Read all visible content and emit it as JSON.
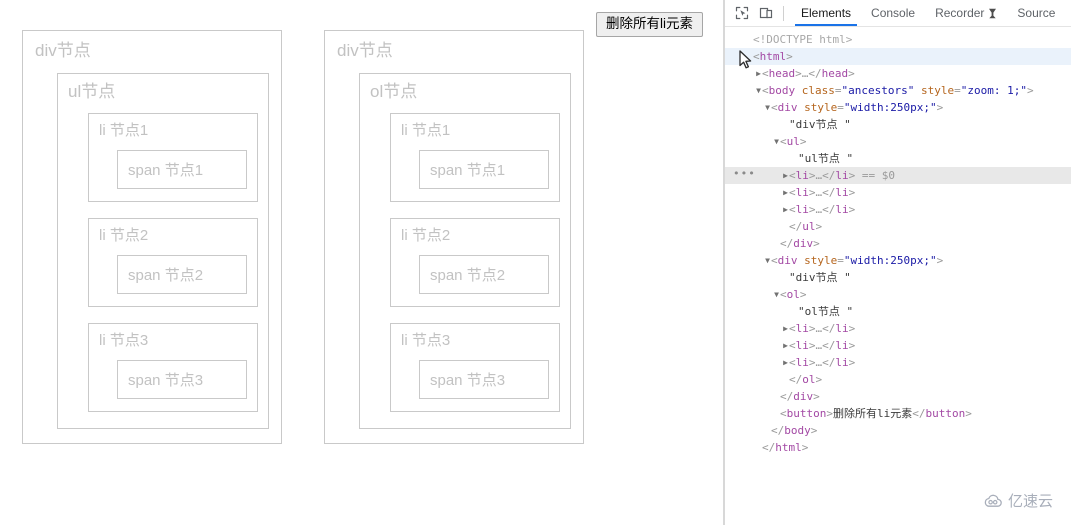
{
  "page": {
    "columns": [
      {
        "container_label": "div节点",
        "list_label": "ul节点",
        "items": [
          {
            "li_label": "li 节点1",
            "span_label": "span 节点1"
          },
          {
            "li_label": "li 节点2",
            "span_label": "span 节点2"
          },
          {
            "li_label": "li 节点3",
            "span_label": "span 节点3"
          }
        ]
      },
      {
        "container_label": "div节点",
        "list_label": "ol节点",
        "items": [
          {
            "li_label": "li 节点1",
            "span_label": "span 节点1"
          },
          {
            "li_label": "li 节点2",
            "span_label": "span 节点2"
          },
          {
            "li_label": "li 节点3",
            "span_label": "span 节点3"
          }
        ]
      }
    ],
    "delete_button_label": "删除所有li元素"
  },
  "devtools": {
    "toolbar": {
      "inspect_icon": "inspect-element-icon",
      "device_icon": "device-toolbar-icon"
    },
    "tabs": [
      {
        "label": "Elements",
        "active": true,
        "icon": ""
      },
      {
        "label": "Console",
        "active": false,
        "icon": ""
      },
      {
        "label": "Recorder",
        "active": false,
        "icon": "experiment-flask-icon"
      },
      {
        "label": "Source",
        "active": false,
        "icon": ""
      }
    ],
    "dom_rows": [
      {
        "indent": 0,
        "twisty": "",
        "highlight": "",
        "dots": false,
        "parts": [
          {
            "cls": "doctype",
            "t": "<!DOCTYPE html>"
          }
        ]
      },
      {
        "indent": 0,
        "twisty": "",
        "highlight": "light",
        "dots": false,
        "parts": [
          {
            "cls": "punct",
            "t": "<"
          },
          {
            "cls": "tagname",
            "t": "html"
          },
          {
            "cls": "punct",
            "t": ">"
          }
        ]
      },
      {
        "indent": 1,
        "twisty": "right",
        "highlight": "",
        "dots": false,
        "parts": [
          {
            "cls": "punct",
            "t": "<"
          },
          {
            "cls": "tagname",
            "t": "head"
          },
          {
            "cls": "punct",
            "t": ">…</"
          },
          {
            "cls": "tagname",
            "t": "head"
          },
          {
            "cls": "punct",
            "t": ">"
          }
        ]
      },
      {
        "indent": 1,
        "twisty": "down",
        "highlight": "",
        "dots": false,
        "parts": [
          {
            "cls": "punct",
            "t": "<"
          },
          {
            "cls": "tagname",
            "t": "body"
          },
          {
            "cls": "punct",
            "t": " "
          },
          {
            "cls": "attrname",
            "t": "class"
          },
          {
            "cls": "punct",
            "t": "="
          },
          {
            "cls": "attrval",
            "t": "\"ancestors\""
          },
          {
            "cls": "punct",
            "t": " "
          },
          {
            "cls": "attrname",
            "t": "style"
          },
          {
            "cls": "punct",
            "t": "="
          },
          {
            "cls": "attrval",
            "t": "\"zoom: 1;\""
          },
          {
            "cls": "punct",
            "t": ">"
          }
        ]
      },
      {
        "indent": 2,
        "twisty": "down",
        "highlight": "",
        "dots": false,
        "parts": [
          {
            "cls": "punct",
            "t": "<"
          },
          {
            "cls": "tagname",
            "t": "div"
          },
          {
            "cls": "punct",
            "t": " "
          },
          {
            "cls": "attrname",
            "t": "style"
          },
          {
            "cls": "punct",
            "t": "="
          },
          {
            "cls": "attrval",
            "t": "\"width:250px;\""
          },
          {
            "cls": "punct",
            "t": ">"
          }
        ]
      },
      {
        "indent": 4,
        "twisty": "",
        "highlight": "",
        "dots": false,
        "parts": [
          {
            "cls": "textnode",
            "t": "\"div节点 \""
          }
        ]
      },
      {
        "indent": 3,
        "twisty": "down",
        "highlight": "",
        "dots": false,
        "parts": [
          {
            "cls": "punct",
            "t": "<"
          },
          {
            "cls": "tagname",
            "t": "ul"
          },
          {
            "cls": "punct",
            "t": ">"
          }
        ]
      },
      {
        "indent": 5,
        "twisty": "",
        "highlight": "",
        "dots": false,
        "parts": [
          {
            "cls": "textnode",
            "t": "\"ul节点 \""
          }
        ]
      },
      {
        "indent": 4,
        "twisty": "right",
        "highlight": "grey",
        "dots": true,
        "parts": [
          {
            "cls": "punct",
            "t": "<"
          },
          {
            "cls": "tagname",
            "t": "li"
          },
          {
            "cls": "punct",
            "t": ">…</"
          },
          {
            "cls": "tagname",
            "t": "li"
          },
          {
            "cls": "punct",
            "t": ">"
          },
          {
            "cls": "dollar",
            "t": " == $0"
          }
        ]
      },
      {
        "indent": 4,
        "twisty": "right",
        "highlight": "",
        "dots": false,
        "parts": [
          {
            "cls": "punct",
            "t": "<"
          },
          {
            "cls": "tagname",
            "t": "li"
          },
          {
            "cls": "punct",
            "t": ">…</"
          },
          {
            "cls": "tagname",
            "t": "li"
          },
          {
            "cls": "punct",
            "t": ">"
          }
        ]
      },
      {
        "indent": 4,
        "twisty": "right",
        "highlight": "",
        "dots": false,
        "parts": [
          {
            "cls": "punct",
            "t": "<"
          },
          {
            "cls": "tagname",
            "t": "li"
          },
          {
            "cls": "punct",
            "t": ">…</"
          },
          {
            "cls": "tagname",
            "t": "li"
          },
          {
            "cls": "punct",
            "t": ">"
          }
        ]
      },
      {
        "indent": 4,
        "twisty": "",
        "highlight": "",
        "dots": false,
        "parts": [
          {
            "cls": "punct",
            "t": "</"
          },
          {
            "cls": "tagname",
            "t": "ul"
          },
          {
            "cls": "punct",
            "t": ">"
          }
        ]
      },
      {
        "indent": 3,
        "twisty": "",
        "highlight": "",
        "dots": false,
        "parts": [
          {
            "cls": "punct",
            "t": "</"
          },
          {
            "cls": "tagname",
            "t": "div"
          },
          {
            "cls": "punct",
            "t": ">"
          }
        ]
      },
      {
        "indent": 2,
        "twisty": "down",
        "highlight": "",
        "dots": false,
        "parts": [
          {
            "cls": "punct",
            "t": "<"
          },
          {
            "cls": "tagname",
            "t": "div"
          },
          {
            "cls": "punct",
            "t": " "
          },
          {
            "cls": "attrname",
            "t": "style"
          },
          {
            "cls": "punct",
            "t": "="
          },
          {
            "cls": "attrval",
            "t": "\"width:250px;\""
          },
          {
            "cls": "punct",
            "t": ">"
          }
        ]
      },
      {
        "indent": 4,
        "twisty": "",
        "highlight": "",
        "dots": false,
        "parts": [
          {
            "cls": "textnode",
            "t": "\"div节点 \""
          }
        ]
      },
      {
        "indent": 3,
        "twisty": "down",
        "highlight": "",
        "dots": false,
        "parts": [
          {
            "cls": "punct",
            "t": "<"
          },
          {
            "cls": "tagname",
            "t": "ol"
          },
          {
            "cls": "punct",
            "t": ">"
          }
        ]
      },
      {
        "indent": 5,
        "twisty": "",
        "highlight": "",
        "dots": false,
        "parts": [
          {
            "cls": "textnode",
            "t": "\"ol节点 \""
          }
        ]
      },
      {
        "indent": 4,
        "twisty": "right",
        "highlight": "",
        "dots": false,
        "parts": [
          {
            "cls": "punct",
            "t": "<"
          },
          {
            "cls": "tagname",
            "t": "li"
          },
          {
            "cls": "punct",
            "t": ">…</"
          },
          {
            "cls": "tagname",
            "t": "li"
          },
          {
            "cls": "punct",
            "t": ">"
          }
        ]
      },
      {
        "indent": 4,
        "twisty": "right",
        "highlight": "",
        "dots": false,
        "parts": [
          {
            "cls": "punct",
            "t": "<"
          },
          {
            "cls": "tagname",
            "t": "li"
          },
          {
            "cls": "punct",
            "t": ">…</"
          },
          {
            "cls": "tagname",
            "t": "li"
          },
          {
            "cls": "punct",
            "t": ">"
          }
        ]
      },
      {
        "indent": 4,
        "twisty": "right",
        "highlight": "",
        "dots": false,
        "parts": [
          {
            "cls": "punct",
            "t": "<"
          },
          {
            "cls": "tagname",
            "t": "li"
          },
          {
            "cls": "punct",
            "t": ">…</"
          },
          {
            "cls": "tagname",
            "t": "li"
          },
          {
            "cls": "punct",
            "t": ">"
          }
        ]
      },
      {
        "indent": 4,
        "twisty": "",
        "highlight": "",
        "dots": false,
        "parts": [
          {
            "cls": "punct",
            "t": "</"
          },
          {
            "cls": "tagname",
            "t": "ol"
          },
          {
            "cls": "punct",
            "t": ">"
          }
        ]
      },
      {
        "indent": 3,
        "twisty": "",
        "highlight": "",
        "dots": false,
        "parts": [
          {
            "cls": "punct",
            "t": "</"
          },
          {
            "cls": "tagname",
            "t": "div"
          },
          {
            "cls": "punct",
            "t": ">"
          }
        ]
      },
      {
        "indent": 3,
        "twisty": "",
        "highlight": "",
        "dots": false,
        "parts": [
          {
            "cls": "punct",
            "t": "<"
          },
          {
            "cls": "tagname",
            "t": "button"
          },
          {
            "cls": "punct",
            "t": ">"
          },
          {
            "cls": "textnode",
            "t": "删除所有li元素"
          },
          {
            "cls": "punct",
            "t": "</"
          },
          {
            "cls": "tagname",
            "t": "button"
          },
          {
            "cls": "punct",
            "t": ">"
          }
        ]
      },
      {
        "indent": 2,
        "twisty": "",
        "highlight": "",
        "dots": false,
        "parts": [
          {
            "cls": "punct",
            "t": "</"
          },
          {
            "cls": "tagname",
            "t": "body"
          },
          {
            "cls": "punct",
            "t": ">"
          }
        ]
      },
      {
        "indent": 1,
        "twisty": "",
        "highlight": "",
        "dots": false,
        "parts": [
          {
            "cls": "punct",
            "t": "</"
          },
          {
            "cls": "tagname",
            "t": "html"
          },
          {
            "cls": "punct",
            "t": ">"
          }
        ]
      }
    ]
  },
  "watermark": {
    "text": "亿速云",
    "icon": "cloud-icon"
  },
  "colors": {
    "accent": "#1a73e8",
    "tagname": "#a349a4",
    "attrname": "#b5651d",
    "attrval": "#1a1aa6",
    "node_border": "#c9c9c9",
    "node_text": "#c2c2c2"
  }
}
